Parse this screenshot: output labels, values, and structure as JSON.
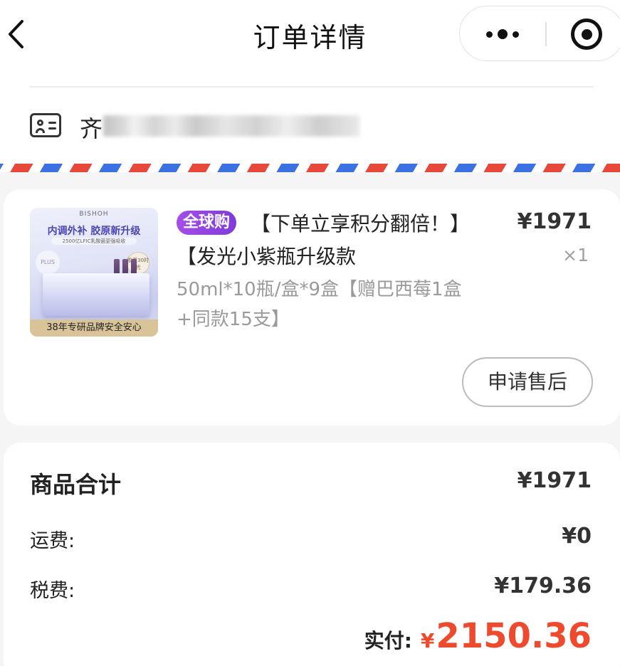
{
  "header": {
    "title": "订单详情"
  },
  "address": {
    "name": "齐"
  },
  "product": {
    "tag": "全球购",
    "title": "【下单立享积分翻倍！】【发光小紫瓶升级款",
    "spec": "50ml*10瓶/盒*9盒【赠巴西莓1盒+同款15支】",
    "price": "¥1971",
    "quantity": "×1",
    "after_sale_label": "申请售后",
    "image": {
      "brand": "BISHOH",
      "headline": "内调外补 胶原新升级",
      "subline": "2500亿LFIC乳酸菌更强吸收",
      "plus": "PLUS",
      "badge": "胶原30时代",
      "bottom_banner": "38年专研品牌安全安心"
    }
  },
  "summary": {
    "goods_total_label": "商品合计",
    "goods_total_value": "¥1971",
    "shipping_label": "运费:",
    "shipping_value": "¥0",
    "tax_label": "税费:",
    "tax_value": "¥179.36",
    "paid_label": "实付:",
    "paid_currency": "¥",
    "paid_amount": "2150.36"
  },
  "colors": {
    "accent": "#ee4a2e",
    "tag_purple": "#9b48e4",
    "airmail_red": "#e8483a",
    "airmail_blue": "#3c71e3"
  }
}
